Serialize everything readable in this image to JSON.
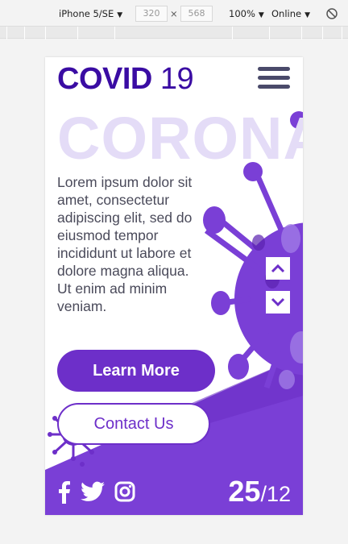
{
  "devtools": {
    "device": "iPhone 5/SE",
    "width_value": "320",
    "separator": "×",
    "height_value": "568",
    "zoom": "100%",
    "network": "Online",
    "dropdown_glyph": "▼"
  },
  "page": {
    "logo_bold": "COVID",
    "logo_light": "19",
    "hero_word": "CORONA",
    "body_text": "Lorem ipsum dolor sit amet, consectetur adipiscing elit, sed do eiusmod tempor incididunt ut labore et dolore magna aliqua. Ut enim ad minim veniam.",
    "learn_more": "Learn More",
    "contact_us": "Contact Us",
    "date_day": "25",
    "date_month": "/12"
  },
  "colors": {
    "brand_dark": "#3a0ca3",
    "brand_purple": "#6d2fc9",
    "hero_tint": "#e4dcf7",
    "virus": "#7a3fd6"
  },
  "icons": [
    "menu-icon",
    "arrow-up-icon",
    "arrow-down-icon",
    "facebook-icon",
    "twitter-icon",
    "instagram-icon",
    "block-icon",
    "virus-illustration"
  ]
}
